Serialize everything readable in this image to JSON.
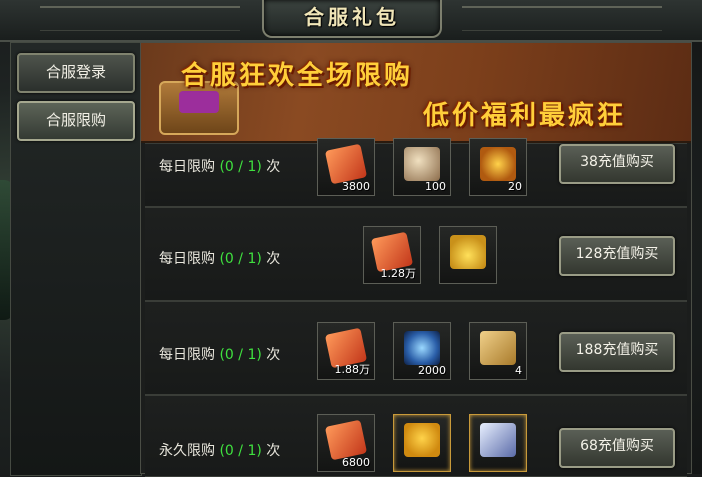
{
  "window": {
    "title": "合服礼包"
  },
  "nav": {
    "items": [
      {
        "label": "合服登录",
        "active": false
      },
      {
        "label": "合服限购",
        "active": true
      }
    ]
  },
  "banner": {
    "line1": "合服狂欢全场限购",
    "line2": "低价福利最疯狂"
  },
  "rows": [
    {
      "label": "每日限购",
      "count": "(0 / 1)",
      "suffix": "次",
      "items": [
        {
          "icon": "red-scroll-icon",
          "qty": "3800"
        },
        {
          "icon": "pouch-icon",
          "qty": "100"
        },
        {
          "icon": "gold-orb-icon",
          "qty": "20"
        }
      ],
      "button": "38充值购买"
    },
    {
      "label": "每日限购",
      "count": "(0 / 1)",
      "suffix": "次",
      "items": [
        {
          "icon": "red-scroll-icon",
          "qty": "1.28万"
        },
        {
          "icon": "gold-bag-icon",
          "qty": ""
        }
      ],
      "button": "128充值购买"
    },
    {
      "label": "每日限购",
      "count": "(0 / 1)",
      "suffix": "次",
      "items": [
        {
          "icon": "red-scroll-icon",
          "qty": "1.88万"
        },
        {
          "icon": "blue-swirl-icon",
          "qty": "2000"
        },
        {
          "icon": "treasure-map-icon",
          "qty": "4"
        }
      ],
      "button": "188充值购买"
    },
    {
      "label": "永久限购",
      "count": "(0 / 1)",
      "suffix": "次",
      "items": [
        {
          "icon": "red-scroll-icon",
          "qty": "6800"
        },
        {
          "icon": "yellow-pet-icon",
          "qty": ""
        },
        {
          "icon": "sword-scroll-icon",
          "qty": ""
        }
      ],
      "button": "68充值购买"
    }
  ],
  "colors": {
    "count_green": "#3fe03f",
    "banner_text": "#ffcf3a",
    "title_text": "#f1e6b8"
  }
}
